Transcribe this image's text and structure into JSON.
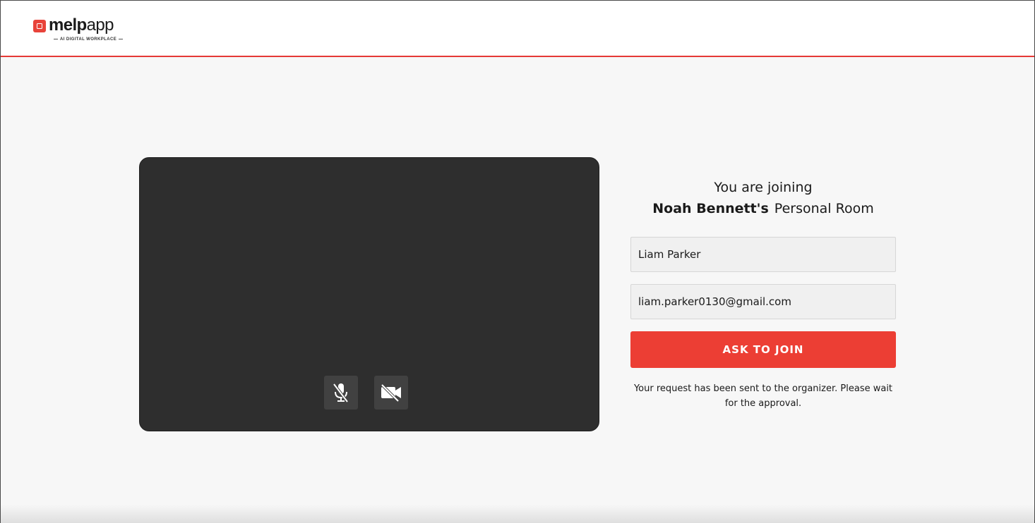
{
  "brand": {
    "name_bold": "melp",
    "name_light": "app",
    "tagline": "AI DIGITAL WORKPLACE",
    "accent_color": "#ec3e34"
  },
  "preview": {
    "mic_icon": "mic-off-icon",
    "camera_icon": "video-off-icon"
  },
  "join": {
    "line1": "You are joining",
    "host_name": "Noah Bennett's",
    "room_label": "Personal Room",
    "name_value": "Liam Parker",
    "email_value": "liam.parker0130@gmail.com",
    "button_label": "ASK TO JOIN",
    "status_message": "Your request has been sent to the organizer. Please wait for the approval."
  }
}
